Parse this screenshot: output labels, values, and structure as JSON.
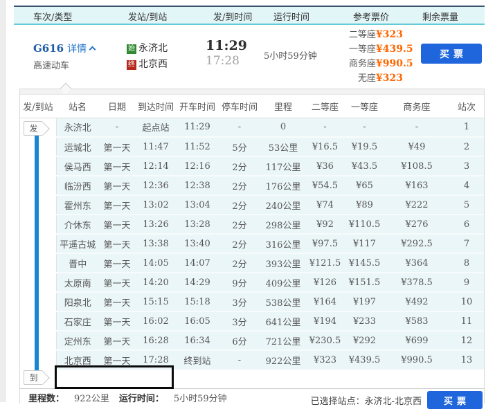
{
  "colors": {
    "accent_blue": "#1f66dd",
    "link_blue": "#2577c8",
    "train_code_blue": "#1d5da8",
    "price_orange": "#ff6600",
    "timeline_blue": "#1787d0",
    "origin_badge_green": "#2f8a2f",
    "dest_badge_red": "#b5291c",
    "header_bg": "#e2f6f8",
    "header_top_border": "#39536b",
    "header_bottom_border": "#65cbd6",
    "row_bg": "#ebf6f9"
  },
  "summary_header": {
    "columns": [
      "车次/类型",
      "发站/到站",
      "发/到时间",
      "运行时间",
      "参考票价",
      "剩余票量"
    ]
  },
  "train": {
    "code": "G616",
    "detail_link": "详情",
    "train_type": "高速动车",
    "origin_badge": "始",
    "origin_station": "永济北",
    "dest_badge": "终",
    "dest_station": "北京西",
    "depart_time": "11:29",
    "arrive_time": "17:28",
    "duration": "5小时59分钟",
    "prices": [
      {
        "label": "二等座",
        "value": "¥323"
      },
      {
        "label": "一等座",
        "value": "¥439.5"
      },
      {
        "label": "商务座",
        "value": "¥990.5"
      },
      {
        "label": "无座",
        "value": "¥323"
      }
    ],
    "buy_button": "买票"
  },
  "stops": {
    "columns": [
      "发/到站",
      "站名",
      "日期",
      "到达时间",
      "开车时间",
      "停车时间",
      "里程",
      "二等座",
      "一等座",
      "商务座",
      "站次"
    ],
    "depart_tag": "发",
    "arrive_tag": "到",
    "rows": [
      {
        "station": "永济北",
        "date": "-",
        "arrive": "起点站",
        "depart": "11:29",
        "stop": "-",
        "distance": "0",
        "second": "-",
        "first": "-",
        "business": "-",
        "index": "1"
      },
      {
        "station": "运城北",
        "date": "第一天",
        "arrive": "11:47",
        "depart": "11:52",
        "stop": "5分",
        "distance": "53公里",
        "second": "¥16.5",
        "first": "¥19.5",
        "business": "¥49",
        "index": "2"
      },
      {
        "station": "侯马西",
        "date": "第一天",
        "arrive": "12:14",
        "depart": "12:16",
        "stop": "2分",
        "distance": "117公里",
        "second": "¥36",
        "first": "¥43.5",
        "business": "¥108.5",
        "index": "3"
      },
      {
        "station": "临汾西",
        "date": "第一天",
        "arrive": "12:36",
        "depart": "12:38",
        "stop": "2分",
        "distance": "176公里",
        "second": "¥54.5",
        "first": "¥65",
        "business": "¥163",
        "index": "4"
      },
      {
        "station": "霍州东",
        "date": "第一天",
        "arrive": "13:02",
        "depart": "13:04",
        "stop": "2分",
        "distance": "240公里",
        "second": "¥74",
        "first": "¥89",
        "business": "¥222",
        "index": "5"
      },
      {
        "station": "介休东",
        "date": "第一天",
        "arrive": "13:26",
        "depart": "13:28",
        "stop": "2分",
        "distance": "298公里",
        "second": "¥92",
        "first": "¥110.5",
        "business": "¥276",
        "index": "6"
      },
      {
        "station": "平遥古城",
        "date": "第一天",
        "arrive": "13:38",
        "depart": "13:40",
        "stop": "2分",
        "distance": "316公里",
        "second": "¥97.5",
        "first": "¥117",
        "business": "¥292.5",
        "index": "7"
      },
      {
        "station": "晋中",
        "date": "第一天",
        "arrive": "14:05",
        "depart": "14:07",
        "stop": "2分",
        "distance": "393公里",
        "second": "¥121.5",
        "first": "¥145.5",
        "business": "¥364",
        "index": "8"
      },
      {
        "station": "太原南",
        "date": "第一天",
        "arrive": "14:20",
        "depart": "14:29",
        "stop": "9分",
        "distance": "409公里",
        "second": "¥126",
        "first": "¥151.5",
        "business": "¥378.5",
        "index": "9"
      },
      {
        "station": "阳泉北",
        "date": "第一天",
        "arrive": "15:15",
        "depart": "15:18",
        "stop": "3分",
        "distance": "538公里",
        "second": "¥164",
        "first": "¥197",
        "business": "¥492",
        "index": "10"
      },
      {
        "station": "石家庄",
        "date": "第一天",
        "arrive": "16:02",
        "depart": "16:05",
        "stop": "3分",
        "distance": "641公里",
        "second": "¥194",
        "first": "¥233",
        "business": "¥583",
        "index": "11"
      },
      {
        "station": "定州东",
        "date": "第一天",
        "arrive": "16:28",
        "depart": "16:34",
        "stop": "6分",
        "distance": "721公里",
        "second": "¥230.5",
        "first": "¥292",
        "business": "¥699",
        "index": "12"
      },
      {
        "station": "北京西",
        "date": "第一天",
        "arrive": "17:28",
        "depart": "终到站",
        "stop": "-",
        "distance": "922公里",
        "second": "¥323",
        "first": "¥439.5",
        "business": "¥990.5",
        "index": "13"
      }
    ]
  },
  "footer": {
    "mileage_label": "里程数：",
    "mileage_value": "922公里",
    "duration_label": "运行时间：",
    "duration_value": "5小时59分钟",
    "selected_stations": "已选择站点：永济北-北京西",
    "buy_button": "买票"
  }
}
